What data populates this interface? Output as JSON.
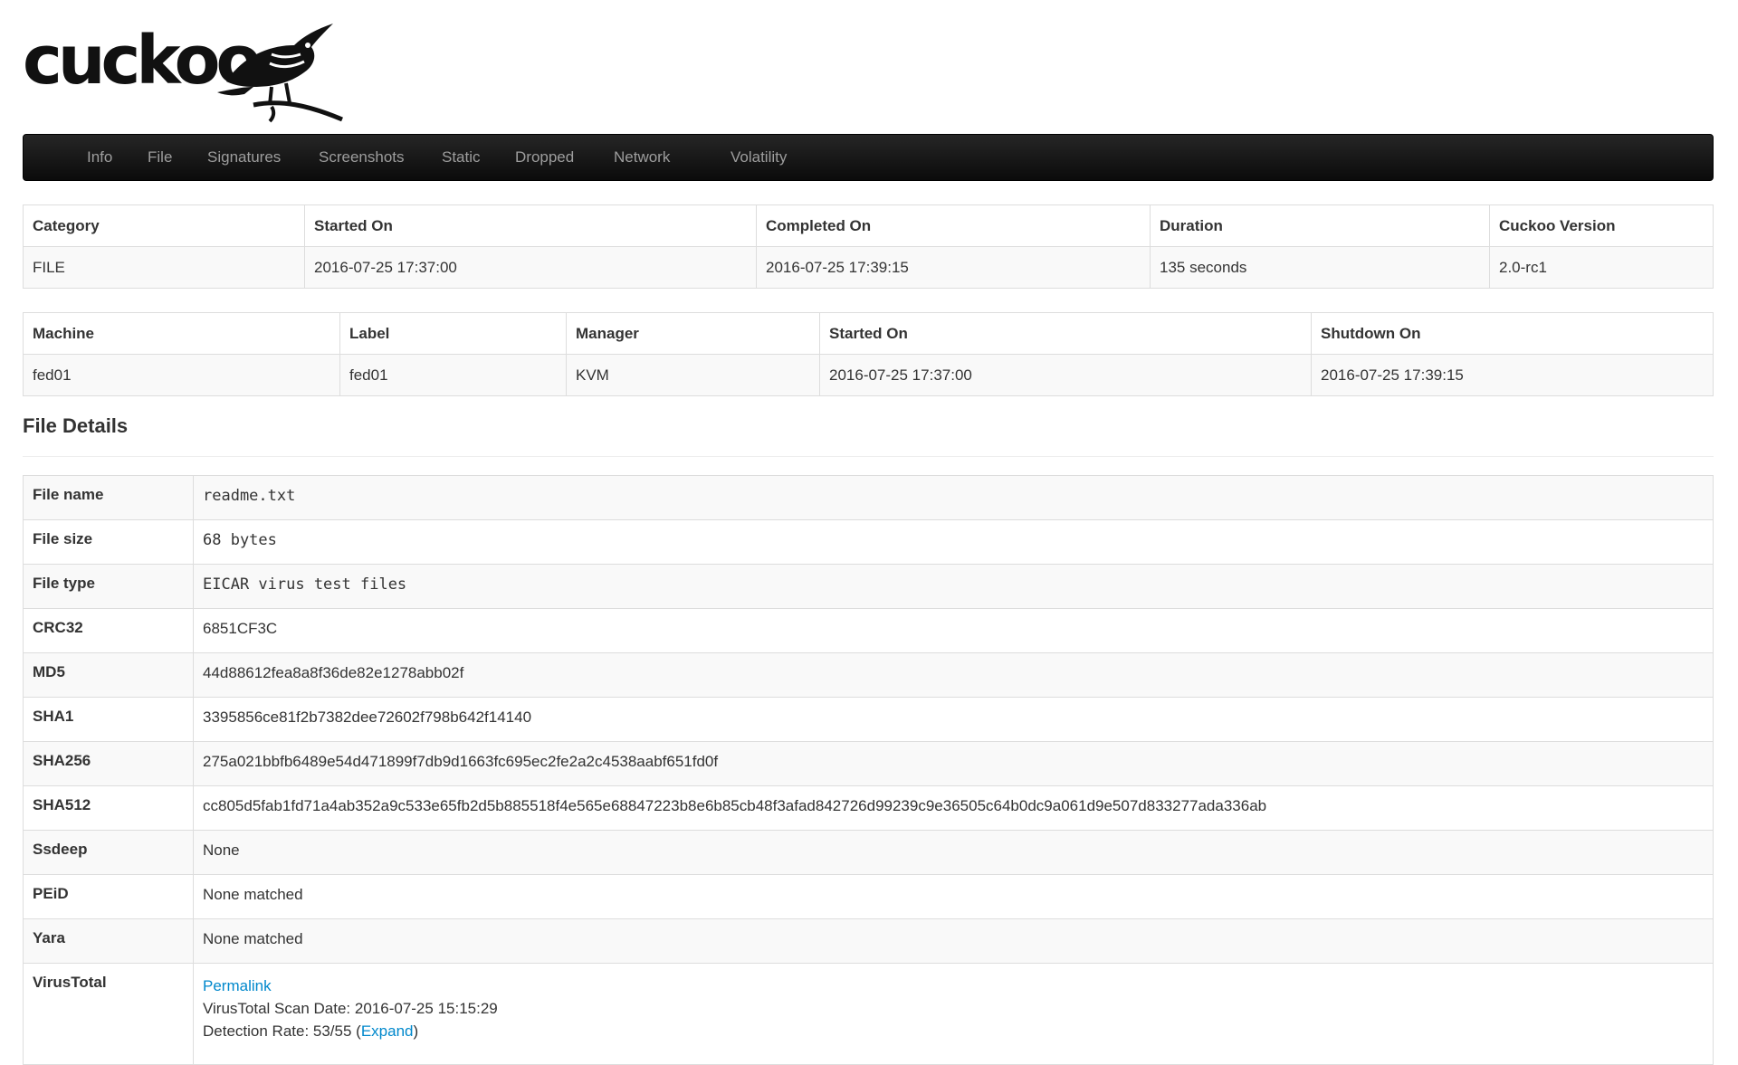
{
  "logo": {
    "text": "cuckoo"
  },
  "nav": {
    "items": [
      "Info",
      "File",
      "Signatures",
      "Screenshots",
      "Static",
      "Dropped",
      "Network",
      "Volatility"
    ]
  },
  "info_table": {
    "headers": [
      "Category",
      "Started On",
      "Completed On",
      "Duration",
      "Cuckoo Version"
    ],
    "values": [
      "FILE",
      "2016-07-25 17:37:00",
      "2016-07-25 17:39:15",
      "135 seconds",
      "2.0-rc1"
    ]
  },
  "machine_table": {
    "headers": [
      "Machine",
      "Label",
      "Manager",
      "Started On",
      "Shutdown On"
    ],
    "values": [
      "fed01",
      "fed01",
      "KVM",
      "2016-07-25 17:37:00",
      "2016-07-25 17:39:15"
    ]
  },
  "file_details": {
    "title": "File Details",
    "rows": [
      {
        "label": "File name",
        "value": "readme.txt"
      },
      {
        "label": "File size",
        "value": "68 bytes"
      },
      {
        "label": "File type",
        "value": "EICAR virus test files"
      },
      {
        "label": "CRC32",
        "value": "6851CF3C"
      },
      {
        "label": "MD5",
        "value": "44d88612fea8a8f36de82e1278abb02f"
      },
      {
        "label": "SHA1",
        "value": "3395856ce81f2b7382dee72602f798b642f14140"
      },
      {
        "label": "SHA256",
        "value": "275a021bbfb6489e54d471899f7db9d1663fc695ec2fe2a2c4538aabf651fd0f"
      },
      {
        "label": "SHA512",
        "value": "cc805d5fab1fd71a4ab352a9c533e65fb2d5b885518f4e565e68847223b8e6b85cb48f3afad842726d99239c9e36505c64b0dc9a061d9e507d833277ada336ab"
      },
      {
        "label": "Ssdeep",
        "value": "None"
      },
      {
        "label": "PEiD",
        "value": "None matched"
      },
      {
        "label": "Yara",
        "value": "None matched"
      }
    ],
    "virustotal": {
      "label": "VirusTotal",
      "permalink": "Permalink",
      "scan_date": "VirusTotal Scan Date: 2016-07-25 15:15:29",
      "detection_prefix": "Detection Rate: 53/55 (",
      "expand": "Expand",
      "detection_suffix": ")"
    }
  }
}
